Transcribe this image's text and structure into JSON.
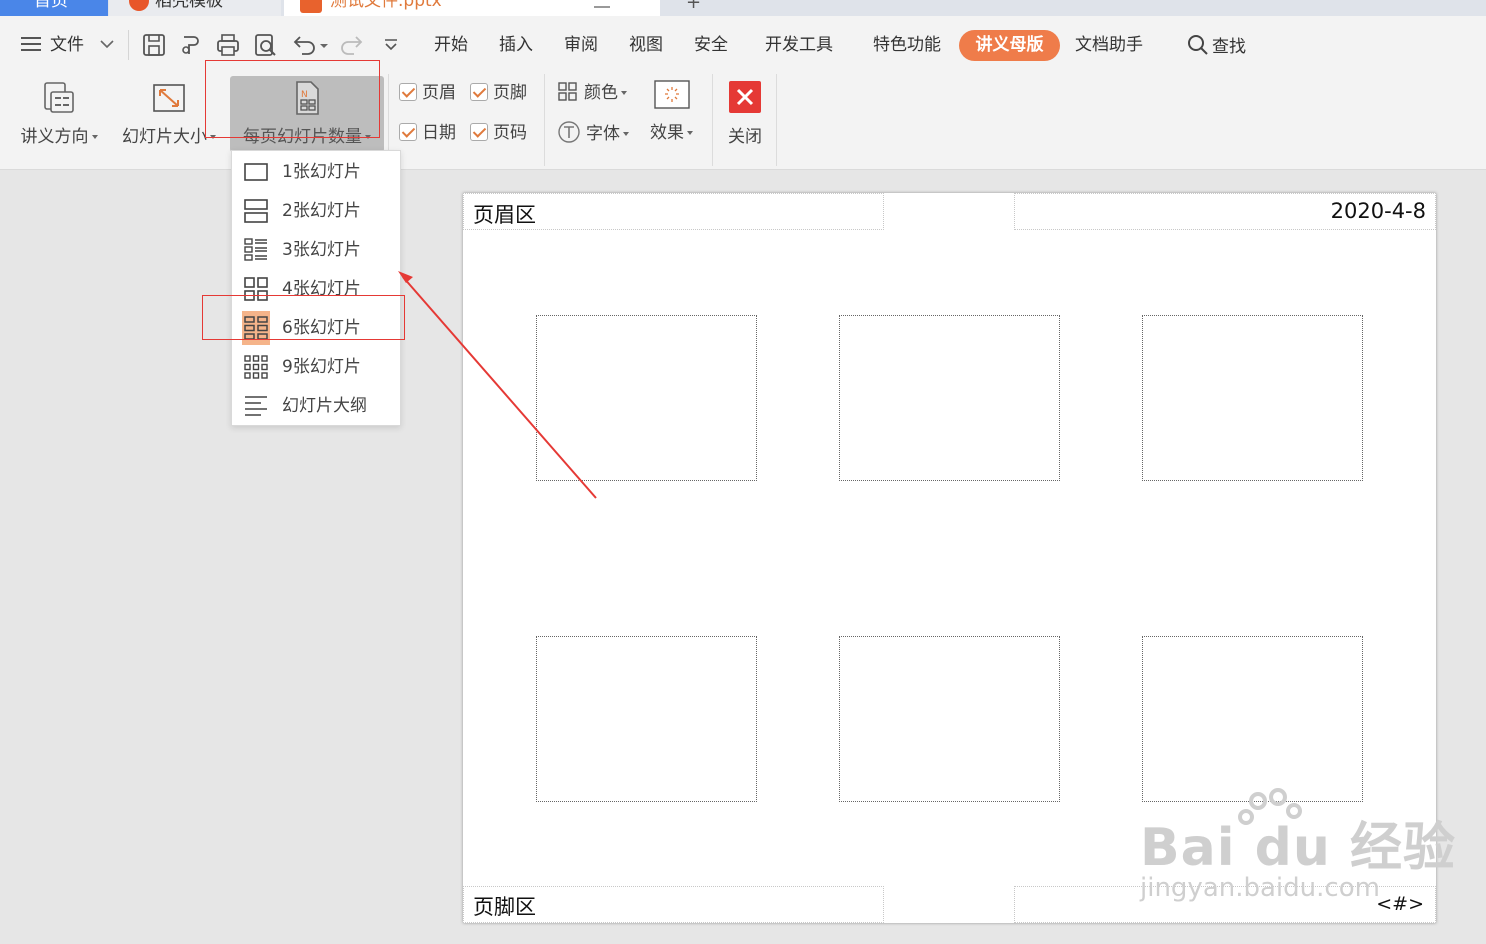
{
  "title_tabs": {
    "home": "首页",
    "template": "稻壳模板",
    "document": "测试文件.pptx",
    "add": "+"
  },
  "menu": {
    "file": "文件",
    "tabs": [
      "开始",
      "插入",
      "审阅",
      "视图",
      "安全",
      "开发工具",
      "特色功能"
    ],
    "active_tab": "讲义母版",
    "after_tabs": [
      "文档助手"
    ],
    "search": "查找"
  },
  "ribbon": {
    "orientation": "讲义方向",
    "slide_size": "幻灯片大小",
    "slides_per_page": "每页幻灯片数量",
    "checks": {
      "header": {
        "label": "页眉",
        "checked": true
      },
      "footer": {
        "label": "页脚",
        "checked": true
      },
      "date": {
        "label": "日期",
        "checked": true
      },
      "page_number": {
        "label": "页码",
        "checked": true
      }
    },
    "colors": "颜色",
    "fonts": "字体",
    "effects": "效果",
    "close": "关闭"
  },
  "dropdown": {
    "items": [
      {
        "label": "1张幻灯片",
        "icon": "one-slide-icon",
        "selected": false
      },
      {
        "label": "2张幻灯片",
        "icon": "two-slides-icon",
        "selected": false
      },
      {
        "label": "3张幻灯片",
        "icon": "three-slides-icon",
        "selected": false
      },
      {
        "label": "4张幻灯片",
        "icon": "four-slides-icon",
        "selected": false
      },
      {
        "label": "6张幻灯片",
        "icon": "six-slides-icon",
        "selected": true
      },
      {
        "label": "9张幻灯片",
        "icon": "nine-slides-icon",
        "selected": false
      },
      {
        "label": "幻灯片大纲",
        "icon": "outline-icon",
        "selected": false
      }
    ]
  },
  "handout": {
    "header": "页眉区",
    "date": "2020-4-8",
    "footer": "页脚区",
    "page_number": "<#>",
    "slides_count": 6
  },
  "watermark": {
    "brand": "Bai du 经验",
    "url": "jingyan.baidu.com"
  },
  "colors": {
    "accent": "#ef7c4a",
    "annotation": "#e53935",
    "selected_item": "#f5b48a"
  }
}
